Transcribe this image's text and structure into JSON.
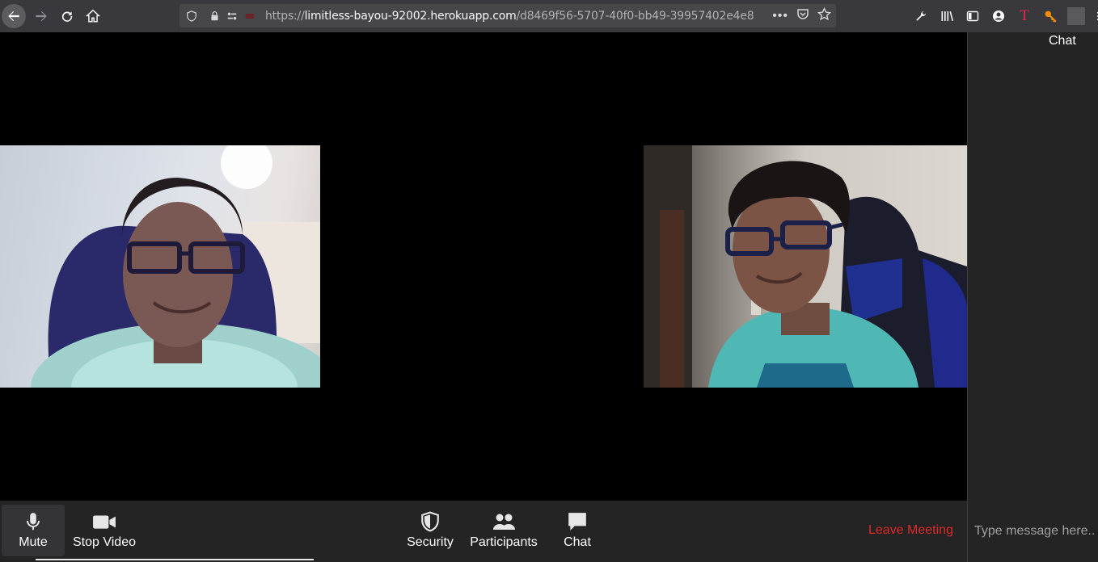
{
  "browser": {
    "url_prefix": "https://",
    "url_host": "limitless-bayou-92002.herokuapp.com",
    "url_path": "/d8469f56-5707-40f0-bb49-39957402e4e8"
  },
  "meeting": {
    "participants_visible": 2
  },
  "controls": {
    "mute_label": "Mute",
    "stop_video_label": "Stop Video",
    "security_label": "Security",
    "participants_label": "Participants",
    "chat_label": "Chat",
    "leave_label": "Leave Meeting"
  },
  "chat_panel": {
    "title": "Chat",
    "input_placeholder": "Type message here..."
  },
  "colors": {
    "leave": "#e02828",
    "toolbar_bg": "#242424",
    "browser_bg": "#38383d"
  }
}
